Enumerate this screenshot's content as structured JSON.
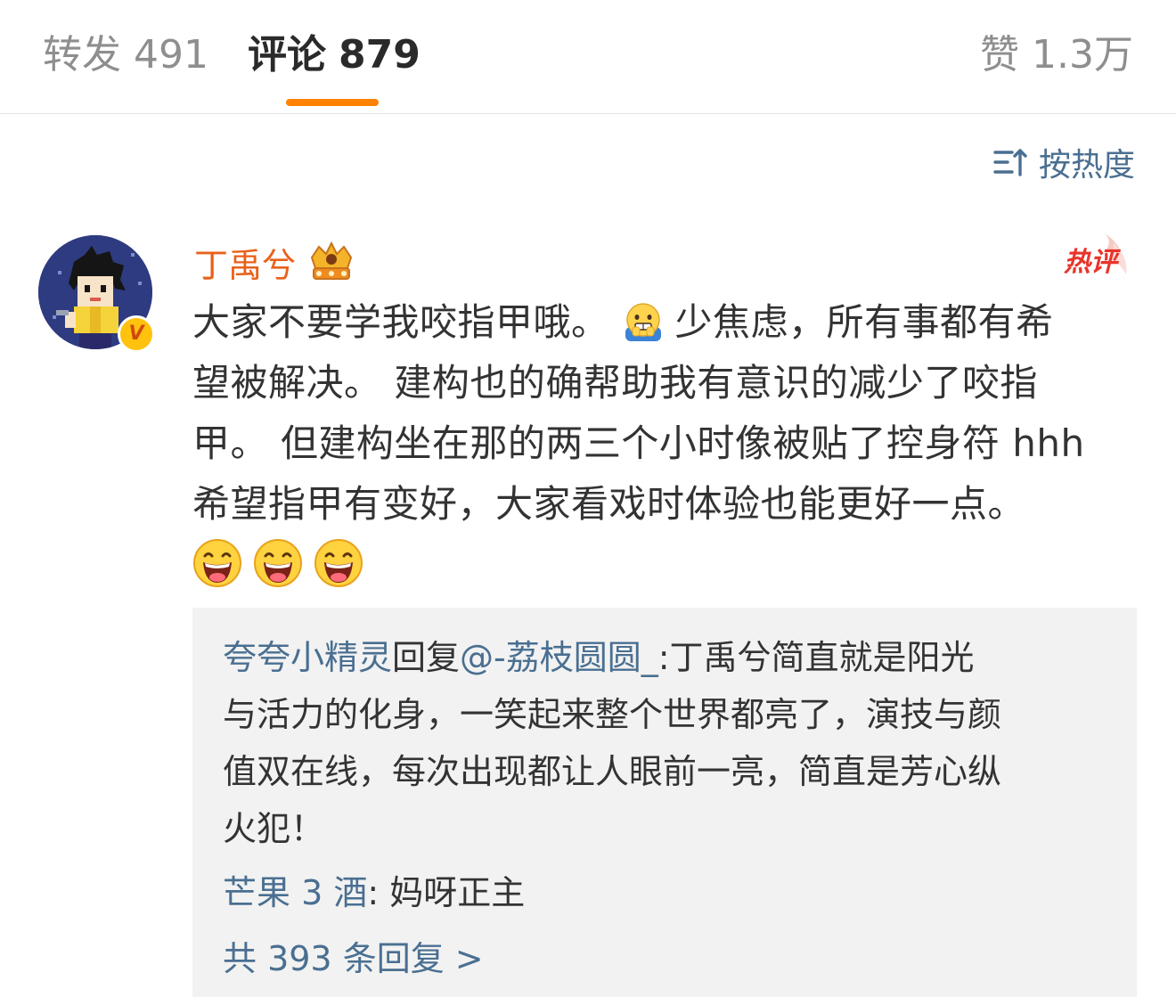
{
  "tabs": {
    "repost": {
      "label": "转发",
      "count": "491"
    },
    "comment": {
      "label": "评论",
      "count": "879"
    },
    "like": {
      "label": "赞",
      "count": "1.3万"
    }
  },
  "sort": {
    "label": "按热度",
    "icon": "sort-icon"
  },
  "comment": {
    "author": "丁禹兮",
    "badge_icon": "crown-icon",
    "verified_mark": "V",
    "hot_tag": "热评",
    "lines": [
      {
        "before": "大家不要学我咬指甲哦。",
        "emoji": "nervous-face-emoji",
        "after": "少焦虑，所有事都有希"
      },
      {
        "text": "望被解决。 建构也的确帮助我有意识的减少了咬指"
      },
      {
        "text": "甲。 但建构坐在那的两三个小时像被贴了控身符 hhh"
      },
      {
        "text": "希望指甲有变好，大家看戏时体验也能更好一点。"
      }
    ],
    "trailing_emojis": [
      "laughing-face-emoji",
      "laughing-face-emoji",
      "laughing-face-emoji"
    ]
  },
  "replies": [
    {
      "user": "夸夸小精灵",
      "reply_word": "回复",
      "mention": "@-荔枝圆圆_",
      "lines": [
        ":丁禹兮简直就是阳光",
        "与活力的化身，一笑起来整个世界都亮了，演技与颜",
        "值双在线，每次出现都让人眼前一亮，简直是芳心纵",
        "火犯！"
      ]
    },
    {
      "user": "芒果 3 酒",
      "text": ": 妈呀正主"
    }
  ],
  "more_replies": "共 393 条回复 >",
  "colors": {
    "accent": "#ff8200",
    "link": "#4a6f91",
    "author": "#e8611a",
    "reply_bg": "#f2f2f2"
  }
}
